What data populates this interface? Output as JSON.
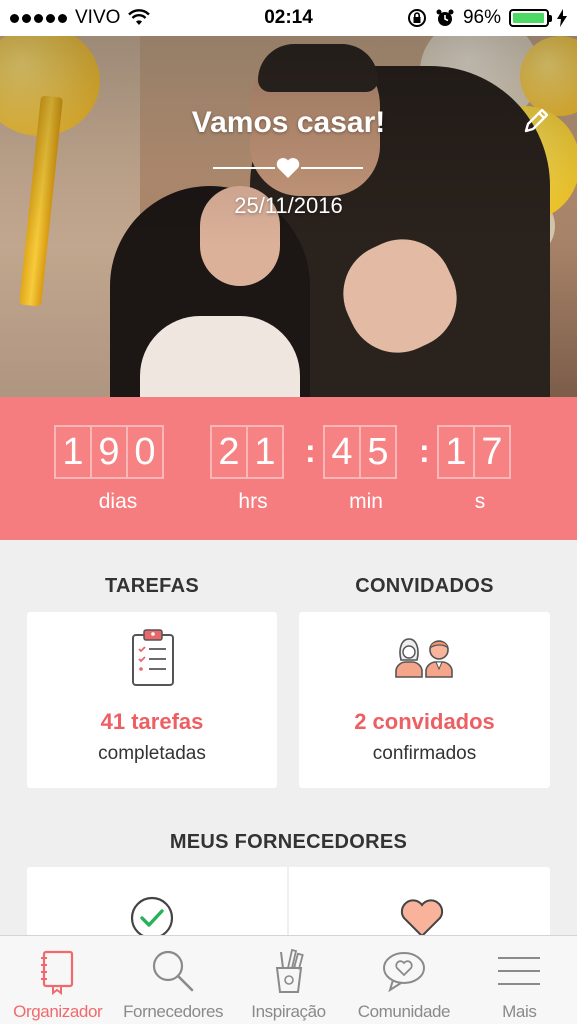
{
  "status_bar": {
    "carrier": "VIVO",
    "time": "02:14",
    "battery_percent": "96%",
    "battery_level": 0.96,
    "icons": [
      "signal-dots-icon",
      "wifi-icon",
      "rotation-lock-icon",
      "alarm-icon",
      "battery-icon",
      "charging-icon"
    ]
  },
  "hero": {
    "title": "Vamos casar!",
    "date": "25/11/2016",
    "edit_icon": "pencil-icon",
    "divider_icon": "heart-icon"
  },
  "countdown": {
    "days": [
      "1",
      "9",
      "0"
    ],
    "hours": [
      "2",
      "1"
    ],
    "minutes": [
      "4",
      "5"
    ],
    "seconds": [
      "1",
      "7"
    ],
    "labels": {
      "days": "dias",
      "hours": "hrs",
      "minutes": "min",
      "seconds": "s"
    },
    "background": "#f67d7f"
  },
  "tasks": {
    "title": "TAREFAS",
    "count_text": "41 tarefas",
    "status_text": "completadas",
    "icon": "clipboard-checklist-icon"
  },
  "guests": {
    "title": "CONVIDADOS",
    "count_text": "2 convidados",
    "status_text": "confirmados",
    "icon": "couple-icon"
  },
  "vendors": {
    "title": "MEUS FORNECEDORES",
    "icons": [
      "check-circle-icon",
      "heart-icon"
    ]
  },
  "tabbar": {
    "items": [
      {
        "label": "Organizador",
        "icon": "notebook-icon",
        "active": true
      },
      {
        "label": "Fornecedores",
        "icon": "search-icon",
        "active": false
      },
      {
        "label": "Inspiração",
        "icon": "pencil-cup-icon",
        "active": false
      },
      {
        "label": "Comunidade",
        "icon": "chat-heart-icon",
        "active": false
      },
      {
        "label": "Mais",
        "icon": "menu-icon",
        "active": false
      }
    ]
  },
  "colors": {
    "accent": "#f06a6d",
    "accent_text": "#ee5f63",
    "inactive_tab": "#8a8a8a",
    "page_background": "#efefef"
  }
}
